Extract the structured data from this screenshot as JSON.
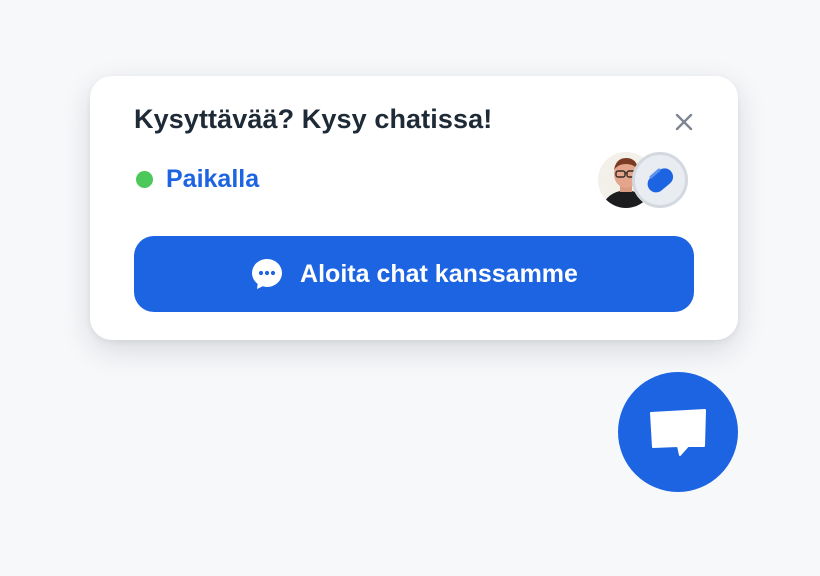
{
  "popup": {
    "title": "Kysyttävää? Kysy chatissa!",
    "status_label": "Paikalla",
    "start_button_label": "Aloita chat kanssamme"
  },
  "icons": {
    "close": "close-icon",
    "status": "online-status-dot",
    "agent": "agent-avatar",
    "brand": "brand-logo-icon",
    "start_chat": "chat-bubble-icon",
    "launcher": "message-bubble-icon"
  },
  "colors": {
    "accent": "#1d64e2",
    "online": "#4cc85a",
    "title_text": "#1f2a37",
    "card_background": "#ffffff",
    "page_background": "#f7f8fa"
  }
}
